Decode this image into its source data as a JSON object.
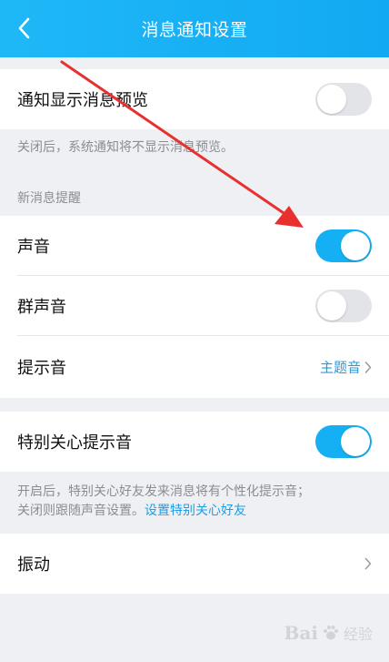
{
  "header": {
    "title": "消息通知设置",
    "back_icon": "chevron-left-icon"
  },
  "preview": {
    "label": "通知显示消息预览",
    "enabled": false,
    "note": "关闭后，系统通知将不显示消息预览。"
  },
  "new_message": {
    "section_label": "新消息提醒",
    "sound": {
      "label": "声音",
      "enabled": true
    },
    "group_sound": {
      "label": "群声音",
      "enabled": false
    },
    "tone": {
      "label": "提示音",
      "value": "主题音"
    }
  },
  "special": {
    "label": "特别关心提示音",
    "enabled": true,
    "note_line1": "开启后，特别关心好友发来消息将有个性化提示音；",
    "note_line2": "关闭则跟随声音设置。",
    "note_link": "设置特别关心好友"
  },
  "vibration": {
    "label": "振动"
  },
  "watermark": {
    "text": "Bai",
    "sub": "经验"
  },
  "colors": {
    "accent": "#14b0f3",
    "link": "#1d9ee6",
    "annotation_arrow": "#e8302f"
  }
}
